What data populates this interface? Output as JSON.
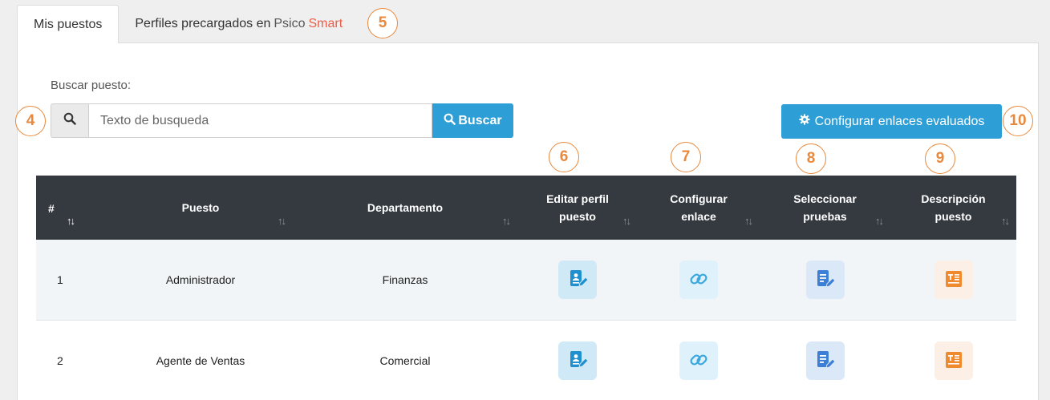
{
  "tabs": [
    {
      "label": "Mis puestos"
    },
    {
      "label": "Perfiles precargados en",
      "psico": "Psico",
      "smart": "Smart"
    }
  ],
  "search": {
    "label": "Buscar puesto:",
    "placeholder": "Texto de busqueda",
    "value": "",
    "button_label": "Buscar"
  },
  "config_button": {
    "label": "Configurar enlaces evaluados"
  },
  "callouts": [
    "4",
    "5",
    "6",
    "7",
    "8",
    "9",
    "10"
  ],
  "table": {
    "headers": [
      {
        "line1": "#",
        "line2": ""
      },
      {
        "line1": "Puesto",
        "line2": ""
      },
      {
        "line1": "Departamento",
        "line2": ""
      },
      {
        "line1": "Editar perfil",
        "line2": "puesto"
      },
      {
        "line1": "Configurar",
        "line2": "enlace"
      },
      {
        "line1": "Seleccionar",
        "line2": "pruebas"
      },
      {
        "line1": "Descripción",
        "line2": "puesto"
      }
    ],
    "rows": [
      {
        "num": "1",
        "puesto": "Administrador",
        "departamento": "Finanzas"
      },
      {
        "num": "2",
        "puesto": "Agente de Ventas",
        "departamento": "Comercial"
      }
    ]
  },
  "icons": {
    "search": "search-icon",
    "gear": "gear-icon",
    "edit": "profile-edit-icon",
    "link": "link-icon",
    "tests": "document-edit-icon",
    "desc": "description-icon",
    "sort": "sort-icon"
  },
  "colors": {
    "primary": "#2d9ed6",
    "header_bg": "#343a40",
    "callout": "#e8893d",
    "smart": "#e8604a",
    "desc_icon": "#f08a2e"
  }
}
